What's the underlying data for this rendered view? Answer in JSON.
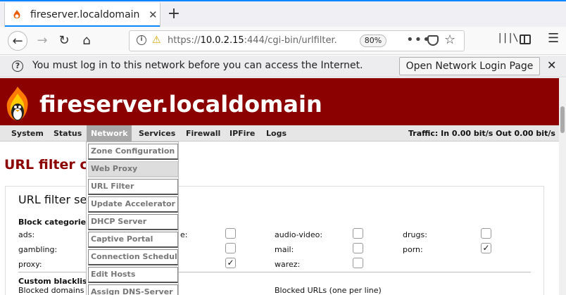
{
  "tab": {
    "title": "fireserver.localdomain - U",
    "close": "✕"
  },
  "newtab": "+",
  "nav": {
    "back": "←",
    "forward": "→",
    "reload": "↻",
    "home": "⌂",
    "url_prefix": "https://",
    "url_host": "10.0.2.15",
    "url_rest": ":444/cgi-bin/urlfilter.",
    "zoom": "80%",
    "more": "•••",
    "star": "☆",
    "library": "|||\\",
    "menu": "☰"
  },
  "notification": {
    "icon": "?",
    "text": "You must log in to this network before you can access the Internet.",
    "button": "Open Network Login Page",
    "close": "✕"
  },
  "site": {
    "title": "fireserver.localdomain"
  },
  "menu": {
    "items": [
      "System",
      "Status",
      "Network",
      "Services",
      "Firewall",
      "IPFire",
      "Logs"
    ],
    "traffic": "Traffic: In 0.00 bit/s   Out 0.00 bit/s"
  },
  "page": {
    "heading": "URL filter conf"
  },
  "box": {
    "title": "URL filter setti",
    "block_categories": "Block categories",
    "categories": [
      {
        "label": "ads:",
        "checked": false
      },
      {
        "label": "audio-video:",
        "checked": false
      },
      {
        "label": "drugs:",
        "checked": false
      },
      {
        "label": "gambling:",
        "checked": false
      },
      {
        "label": "mail:",
        "checked": false
      },
      {
        "label": "porn:",
        "checked": true
      },
      {
        "label": "proxy:",
        "checked": false
      },
      {
        "label": "warez:",
        "checked": false
      }
    ],
    "partial_label": "e:",
    "hidden_col_checks": [
      false,
      false,
      true
    ],
    "custom_blacklist": "Custom blacklist",
    "blocked_domains": "Blocked domains (o",
    "blocked_urls": "Blocked URLs (one per line)"
  },
  "dropdown": {
    "items": [
      "Zone Configuration",
      "Web Proxy",
      "URL Filter",
      "Update Accelerator",
      "DHCP Server",
      "Captive Portal",
      "Connection Scheduler",
      "Edit Hosts",
      "Assign DNS-Server"
    ],
    "hover_item": "Web Proxy"
  },
  "colors": {
    "brand": "#8b0000",
    "menubar": "#e6e6e6",
    "active_menu": "#a8a8a8"
  }
}
